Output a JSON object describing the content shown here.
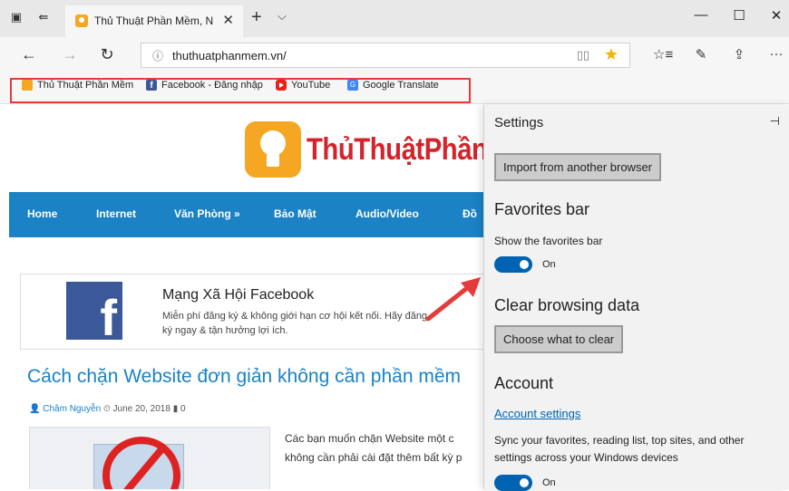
{
  "browser": {
    "tab": {
      "title": "Thủ Thuật Phần Mềm, N",
      "close": "✕"
    },
    "new_tab": "+",
    "tab_menu": "⌵",
    "window": {
      "minimize": "—",
      "maximize": "☐",
      "close": "✕"
    },
    "nav": {
      "back": "←",
      "forward": "→",
      "refresh": "↻"
    },
    "address": {
      "info": "ⓘ",
      "url": "thuthuatphanmem.vn/",
      "reading_view": "📖",
      "favorite_star": "★"
    },
    "toolbar": {
      "hub": "☆≡",
      "notes": "✎",
      "share": "⇪",
      "more": "···"
    }
  },
  "favorites_bar": {
    "items": [
      {
        "label": "Thủ Thuật Phần Mềm",
        "icon": "lightbulb-icon"
      },
      {
        "label": "Facebook - Đăng nhập",
        "icon": "facebook-icon",
        "glyph": "f"
      },
      {
        "label": "YouTube",
        "icon": "youtube-icon"
      },
      {
        "label": "Google Translate",
        "icon": "google-translate-icon",
        "glyph": "G"
      }
    ]
  },
  "site": {
    "logo_text": "ThủThuậtPhần",
    "menu": [
      "Home",
      "Internet",
      "Văn Phòng »",
      "Bảo Mật",
      "Audio/Video",
      "Đồ"
    ],
    "fb_card": {
      "glyph": "f",
      "title": "Mạng Xã Hội Facebook",
      "desc": "Miễn phí đăng ký & không giới hạn cơ hội kết nối. Hãy đăng ký ngay & tận hưởng lợi ích."
    },
    "article": {
      "title": "Cách chặn Website đơn giản không cần phần mềm",
      "author_icon": "👤",
      "author": "Châm Nguyễn",
      "date_icon": "⏲",
      "date": "June 20, 2018",
      "comments_icon": "▮",
      "comments": "0",
      "excerpt_lines": [
        "Các bạn muốn chặn Website một c",
        "không cần phải cài đặt thêm bất kỳ p"
      ]
    }
  },
  "settings": {
    "title": "Settings",
    "pin": "⊣",
    "import_button": "Import from another browser",
    "favorites_bar": {
      "heading": "Favorites bar",
      "label": "Show the favorites bar",
      "toggle_state": "On",
      "enabled": true
    },
    "clear_data": {
      "heading": "Clear browsing data",
      "button": "Choose what to clear"
    },
    "account": {
      "heading": "Account",
      "link": "Account settings",
      "desc": "Sync your favorites, reading list, top sites, and other settings across your Windows devices",
      "toggle_state": "On",
      "enabled": true
    }
  },
  "colors": {
    "accent": "#0063b1",
    "site_blue": "#1a82c5",
    "highlight_red": "#e53b3b",
    "logo_red": "#d4232b",
    "logo_orange": "#f5a623"
  }
}
